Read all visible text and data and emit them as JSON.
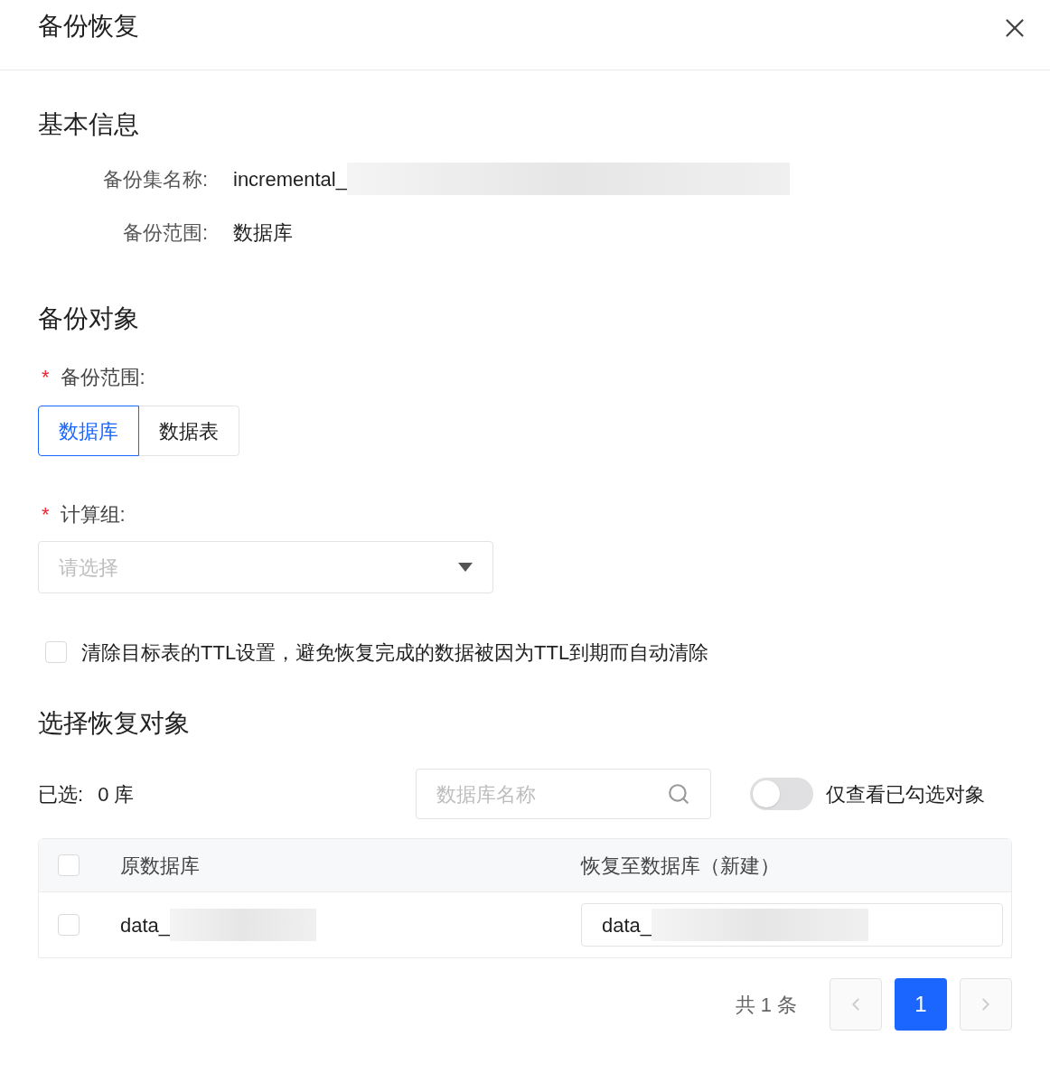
{
  "dialog": {
    "title": "备份恢复"
  },
  "basic_info": {
    "heading": "基本信息",
    "fields": [
      {
        "label": "备份集名称:",
        "value": "incremental_",
        "redacted": true
      },
      {
        "label": "备份范围:",
        "value": "数据库"
      }
    ]
  },
  "backup_object": {
    "heading": "备份对象",
    "scope": {
      "label": "备份范围:",
      "required_mark": "*",
      "options": [
        {
          "label": "数据库",
          "selected": true
        },
        {
          "label": "数据表",
          "selected": false
        }
      ]
    },
    "compute_group": {
      "label": "计算组:",
      "required_mark": "*",
      "placeholder": "请选择"
    },
    "ttl_option": {
      "label": "清除目标表的TTL设置，避免恢复完成的数据被因为TTL到期而自动清除",
      "checked": false
    }
  },
  "restore": {
    "heading": "选择恢复对象",
    "selected_label": "已选:",
    "selected_count": "0 库",
    "search": {
      "placeholder": "数据库名称"
    },
    "toggle": {
      "label": "仅查看已勾选对象",
      "on": false
    },
    "table": {
      "all_checked": false,
      "columns": [
        "原数据库",
        "恢复至数据库（新建）"
      ],
      "rows": [
        {
          "checked": false,
          "source": "data_",
          "source_redacted": true,
          "target": "data_",
          "target_redacted": true
        }
      ]
    },
    "pagination": {
      "total": "共 1 条",
      "pages": [
        {
          "label": "1",
          "selected": true
        }
      ]
    }
  }
}
